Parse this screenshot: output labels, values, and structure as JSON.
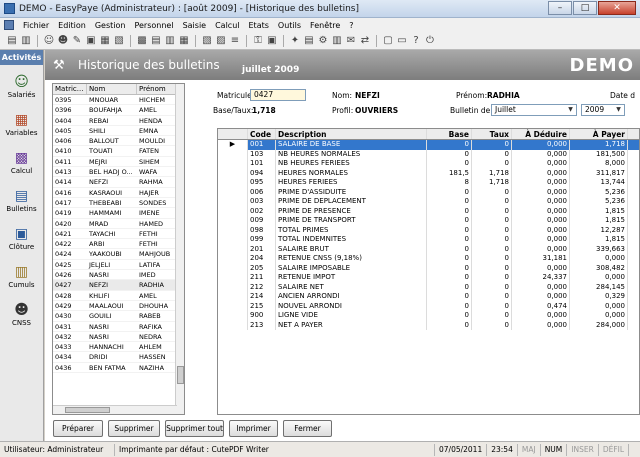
{
  "window": {
    "title": "DEMO - EasyPaye (Administrateur) : [août 2009] - [Historique des bulletins]",
    "min": "–",
    "max": "□",
    "close": "✕"
  },
  "menu": [
    "Fichier",
    "Edition",
    "Gestion",
    "Personnel",
    "Saisie",
    "Calcul",
    "Etats",
    "Outils",
    "Fenêtre",
    "?"
  ],
  "sidebar": {
    "header": "Activités",
    "items": [
      {
        "label": "Salariés",
        "icon": "users-icon"
      },
      {
        "label": "Variables",
        "icon": "variables-icon"
      },
      {
        "label": "Calcul",
        "icon": "calculator-icon"
      },
      {
        "label": "Bulletins",
        "icon": "document-icon"
      },
      {
        "label": "Clôture",
        "icon": "closing-icon"
      },
      {
        "label": "Cumuls",
        "icon": "stack-icon"
      },
      {
        "label": "CNSS",
        "icon": "person-icon"
      }
    ]
  },
  "header": {
    "title": "Historique des bulletins",
    "period": "juillet 2009",
    "demo": "DEMO"
  },
  "employees": {
    "columns": [
      "Matric...",
      "Nom",
      "Prénom"
    ],
    "rows": [
      [
        "0395",
        "MNOUAR",
        "HICHEM"
      ],
      [
        "0396",
        "BOUFAHJA",
        "AMEL"
      ],
      [
        "0404",
        "REBAI",
        "HENDA"
      ],
      [
        "0405",
        "SHILI",
        "EMNA"
      ],
      [
        "0406",
        "BALLOUT",
        "MOULDI"
      ],
      [
        "0410",
        "TOUATI",
        "FATEN"
      ],
      [
        "0411",
        "MEJRI",
        "SIHEM"
      ],
      [
        "0413",
        "BEL HADJ O...",
        "WAFA"
      ],
      [
        "0414",
        "NEFZI",
        "RAHMA"
      ],
      [
        "0416",
        "KASRAOUI",
        "HAJER"
      ],
      [
        "0417",
        "THEBEABI",
        "SONDES"
      ],
      [
        "0419",
        "HAMMAMI",
        "IMENE"
      ],
      [
        "0420",
        "MRAD",
        "HAMED"
      ],
      [
        "0421",
        "TAYACHI",
        "FETHI"
      ],
      [
        "0422",
        "ARBI",
        "FETHI"
      ],
      [
        "0424",
        "YAAKOUBI",
        "MAHJOUB"
      ],
      [
        "0425",
        "JELJELI",
        "LATIFA"
      ],
      [
        "0426",
        "NASRI",
        "IMED"
      ],
      [
        "0427",
        "NEFZI",
        "RADHIA"
      ],
      [
        "0428",
        "KHLIFI",
        "AMEL"
      ],
      [
        "0429",
        "MAALAOUI",
        "DHOUHA"
      ],
      [
        "0430",
        "GOUILI",
        "RABEB"
      ],
      [
        "0431",
        "NASRI",
        "RAFIKA"
      ],
      [
        "0432",
        "NASRI",
        "NEDRA"
      ],
      [
        "0433",
        "HANNACHI",
        "AHLEM"
      ],
      [
        "0434",
        "DRIDI",
        "HASSEN"
      ],
      [
        "0436",
        "BEN FATMA",
        "NAZIHA"
      ]
    ],
    "selected_index": 18
  },
  "form": {
    "matricule_label": "Matricule:",
    "matricule_value": "0427",
    "nom_label": "Nom:",
    "nom_value": "NEFZI",
    "prenom_label": "Prénom:",
    "prenom_value": "RADHIA",
    "date_label": "Date d",
    "base_label": "Base/Taux:",
    "base_value": "1,718",
    "profil_label": "Profil:",
    "profil_value": "OUVRIERS",
    "bulletin_label": "Bulletin de:",
    "month_value": "Juillet",
    "year_value": "2009"
  },
  "grid": {
    "columns": [
      "",
      "Code",
      "Description",
      "Base",
      "Taux",
      "À Déduire",
      "À Payer"
    ],
    "rows": [
      [
        "001",
        "SALAIRE DE BASE",
        "0",
        "0",
        "0,000",
        "1,718"
      ],
      [
        "103",
        "NB HEURES NORMALES",
        "0",
        "0",
        "0,000",
        "181,500"
      ],
      [
        "101",
        "NB HEURES FERIEES",
        "0",
        "0",
        "0,000",
        "8,000"
      ],
      [
        "094",
        "HEURES NORMALES",
        "181,5",
        "1,718",
        "0,000",
        "311,817"
      ],
      [
        "095",
        "HEURES FERIEES",
        "8",
        "1,718",
        "0,000",
        "13,744"
      ],
      [
        "006",
        "PRIME D'ASSIDUITE",
        "0",
        "0",
        "0,000",
        "5,236"
      ],
      [
        "003",
        "PRIME DE DEPLACEMENT",
        "0",
        "0",
        "0,000",
        "5,236"
      ],
      [
        "002",
        "PRIME DE PRESENCE",
        "0",
        "0",
        "0,000",
        "1,815"
      ],
      [
        "009",
        "PRIME DE TRANSPORT",
        "0",
        "0",
        "0,000",
        "1,815"
      ],
      [
        "098",
        "TOTAL PRIMES",
        "0",
        "0",
        "0,000",
        "12,287"
      ],
      [
        "099",
        "TOTAL INDEMNITES",
        "0",
        "0",
        "0,000",
        "1,815"
      ],
      [
        "201",
        "SALAIRE BRUT",
        "0",
        "0",
        "0,000",
        "339,663"
      ],
      [
        "204",
        "RETENUE CNSS   (9,18%)",
        "0",
        "0",
        "31,181",
        "0,000"
      ],
      [
        "205",
        "SALAIRE IMPOSABLE",
        "0",
        "0",
        "0,000",
        "308,482"
      ],
      [
        "211",
        "RETENUE IMPOT",
        "0",
        "0",
        "24,337",
        "0,000"
      ],
      [
        "212",
        "SALAIRE NET",
        "0",
        "0",
        "0,000",
        "284,145"
      ],
      [
        "214",
        "ANCIEN ARRONDI",
        "0",
        "0",
        "0,000",
        "0,329"
      ],
      [
        "215",
        "NOUVEL ARRONDI",
        "0",
        "0",
        "0,474",
        "0,000"
      ],
      [
        "900",
        "LIGNE VIDE",
        "0",
        "0",
        "0,000",
        "0,000"
      ],
      [
        "213",
        "NET A PAYER",
        "0",
        "0",
        "0,000",
        "284,000"
      ]
    ],
    "selected_index": 0
  },
  "buttons": {
    "preparer": "Préparer",
    "supprimer": "Supprimer",
    "supprimer_tout": "Supprimer tout",
    "imprimer": "Imprimer",
    "fermer": "Fermer"
  },
  "status": {
    "user": "Utilisateur: Administrateur",
    "printer": "Imprimante par défaut : CutePDF Writer",
    "date": "07/05/2011",
    "time": "23:54",
    "maj": "MAJ",
    "num": "NUM",
    "inser": "INSER",
    "defil": "DÉFIL"
  },
  "colors": {
    "accent": "#3377cc",
    "header_band": "#8c8c8c",
    "sidebar_header": "#5b7fae"
  }
}
